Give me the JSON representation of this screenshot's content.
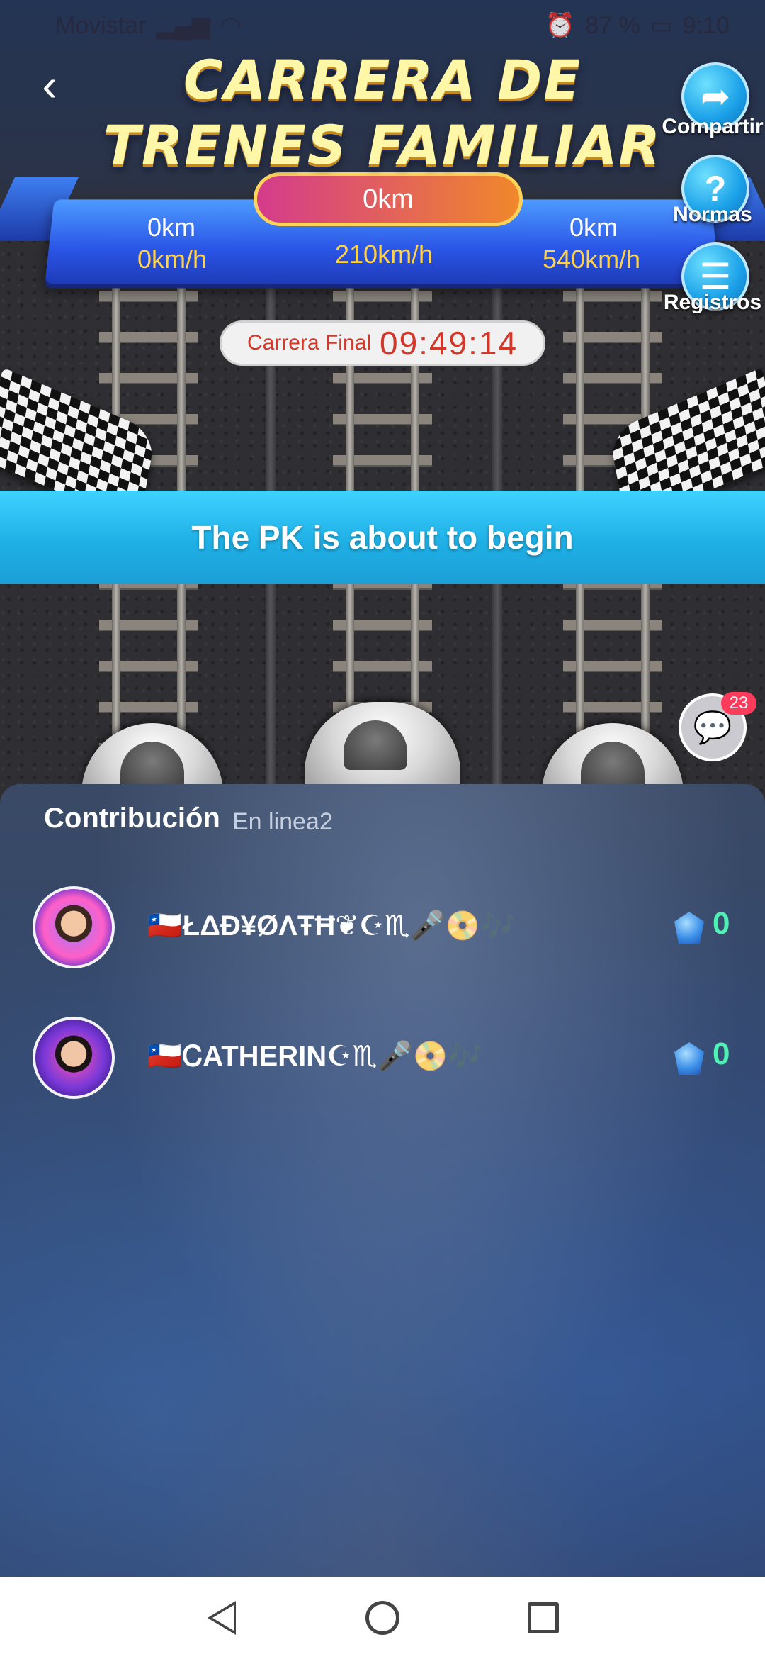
{
  "status_bar": {
    "carrier": "Movistar",
    "battery": "87 %",
    "time": "9:10"
  },
  "header": {
    "title_line1": "CARRERA DE",
    "title_line2": "TRENES FAMILIAR"
  },
  "race": {
    "center_distance": "0km",
    "lanes": [
      {
        "distance": "0km",
        "speed": "0km/h"
      },
      {
        "distance": "",
        "speed": "210km/h"
      },
      {
        "distance": "0km",
        "speed": "540km/h"
      }
    ],
    "timer_label": "Carrera Final",
    "timer_value": "09:49:14",
    "pk_message": "The PK is about to begin"
  },
  "side_buttons": {
    "share": "Compartir",
    "rules": "Normas",
    "records": "Registros"
  },
  "chat": {
    "badge_count": "23"
  },
  "contribution": {
    "title": "Contribución",
    "subtitle": "En linea2",
    "rows": [
      {
        "name": "🇨🇱ŁΔĐ¥ØΛŦĦ❦☪♏🎤📀🎶",
        "score": "0"
      },
      {
        "name": "🇨🇱ᏟATHERIN☪♏🎤📀🎶",
        "score": "0"
      }
    ]
  },
  "icons": {
    "back": "chevron-left-icon",
    "share": "share-arrow-icon",
    "rules": "question-icon",
    "records": "document-icon",
    "chat": "chat-bubble-icon",
    "gem": "diamond-icon"
  },
  "colors": {
    "pk_bar": "#1fb0e6",
    "timer_text": "#d2382a",
    "speed_text": "#ffd24a",
    "score_text": "#4ff0b4"
  }
}
